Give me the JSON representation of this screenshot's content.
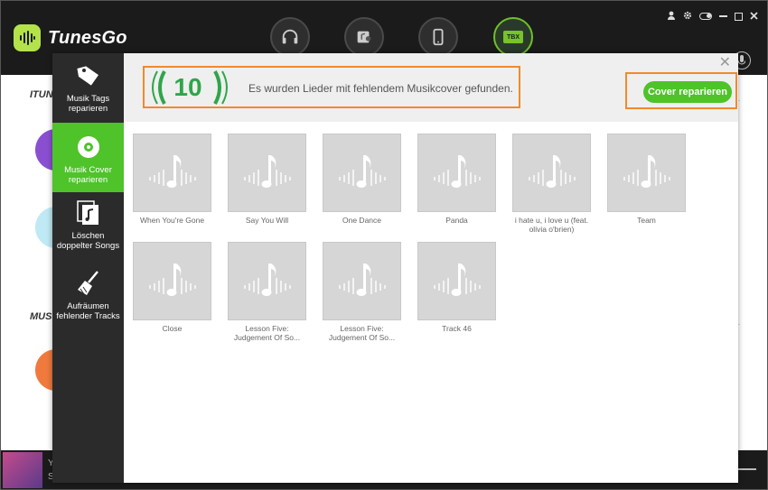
{
  "app": {
    "name": "TunesGo"
  },
  "window_controls": [
    "user-icon",
    "gear-icon",
    "toggle-icon",
    "minimize-icon",
    "maximize-icon",
    "close-icon"
  ],
  "nav": [
    {
      "id": "music",
      "icon": "headphones-icon",
      "active": false
    },
    {
      "id": "video",
      "icon": "media-icon",
      "active": false
    },
    {
      "id": "device",
      "icon": "phone-icon",
      "active": false
    },
    {
      "id": "toolbox",
      "icon": "toolbox-icon",
      "label": "TBX",
      "active": true
    }
  ],
  "background": {
    "section1": "ITUN",
    "section2": "MUS",
    "now_playing_line1": "Y",
    "now_playing_line2": "S"
  },
  "modal": {
    "sidebar": [
      {
        "label": "Musik Tags reparieren",
        "icon": "tag-icon",
        "active": false
      },
      {
        "label": "Musik Cover reparieren",
        "icon": "disc-icon",
        "active": true
      },
      {
        "label": "Löschen doppelter Songs",
        "icon": "duplicate-song-icon",
        "active": false
      },
      {
        "label": "Aufräumen fehlender Tracks",
        "icon": "broom-icon",
        "active": false
      }
    ],
    "header": {
      "count": "10",
      "message": "Es wurden Lieder mit fehlendem Musikcover gefunden.",
      "fix_button": "Cover reparieren"
    },
    "songs": [
      {
        "title": "When You're Gone"
      },
      {
        "title": "Say You Will"
      },
      {
        "title": "One Dance"
      },
      {
        "title": "Panda"
      },
      {
        "title": "i hate u, i love u (feat. olivia o'brien)"
      },
      {
        "title": "Team"
      },
      {
        "title": "Close"
      },
      {
        "title": "Lesson Five: Judgement Of So..."
      },
      {
        "title": "Lesson Five: Judgement Of So..."
      },
      {
        "title": "Track 46"
      }
    ]
  },
  "colors": {
    "accent_green": "#4ec32a",
    "count_green": "#2fa54a",
    "highlight_orange": "#f28a2a",
    "dark": "#1b1b1b"
  }
}
